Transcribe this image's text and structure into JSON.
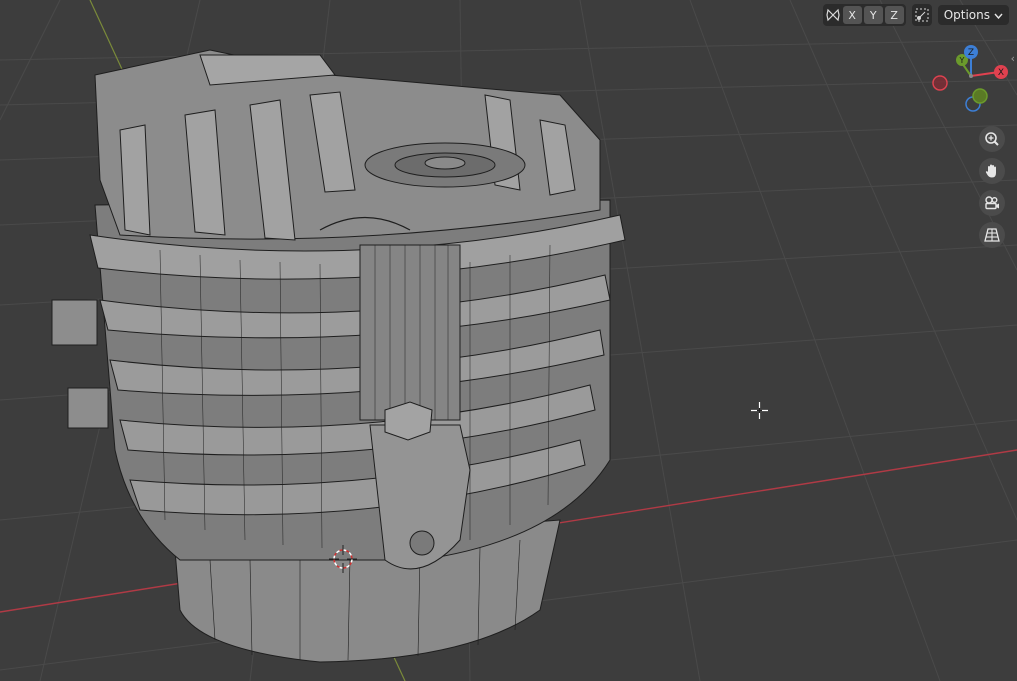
{
  "viewport": {
    "background": "#3d3d3d",
    "grid_color": "#4a4a4a",
    "x_axis_color": "#b03a45",
    "y_axis_color": "#7a8a3a"
  },
  "header": {
    "mirror_icon": "butterfly-mirror-icon",
    "axis_x": "X",
    "axis_y": "Y",
    "axis_z": "Z",
    "snap_icon": "snap-transform-icon",
    "options_label": "Options",
    "options_icon": "chevron-down-icon"
  },
  "gizmo": {
    "z_label": "Z",
    "y_label": "Y",
    "x_label": "X",
    "x_color": "#e0414f",
    "y_color": "#6b9a2c",
    "z_color": "#3d7fd6"
  },
  "nav": {
    "zoom_icon": "zoom-icon",
    "pan_icon": "hand-icon",
    "camera_icon": "camera-icon",
    "ortho_icon": "grid-perspective-icon"
  },
  "model": {
    "fill": "#8e8e8e",
    "shade": "#6f6f6f",
    "wire": "#1e1e1e"
  }
}
